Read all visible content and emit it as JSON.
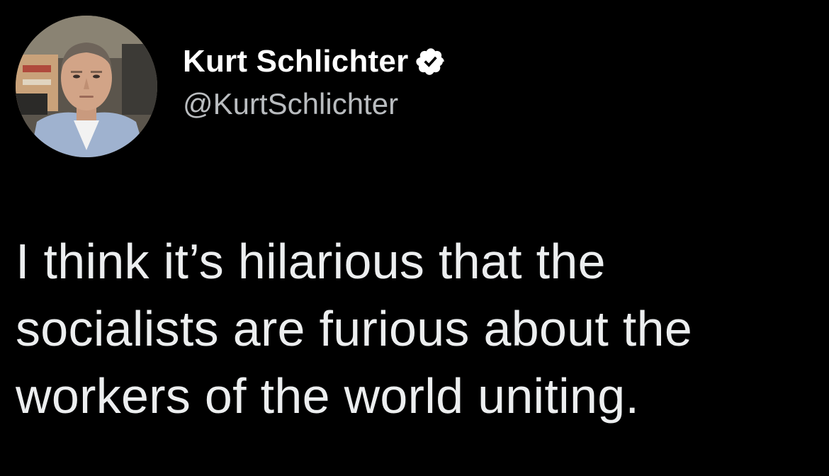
{
  "tweet": {
    "author": {
      "display_name": "Kurt Schlichter",
      "handle": "@KurtSchlichter",
      "verified": true,
      "avatar_icon": "profile-photo",
      "verified_icon": "verified-badge-icon"
    },
    "text_lines": [
      "I think it’s hilarious that the",
      "socialists are furious about the",
      "workers of the world uniting."
    ]
  },
  "colors": {
    "background": "#000000",
    "name": "#ffffff",
    "handle": "#b9bcbf",
    "text": "#eceeef"
  }
}
